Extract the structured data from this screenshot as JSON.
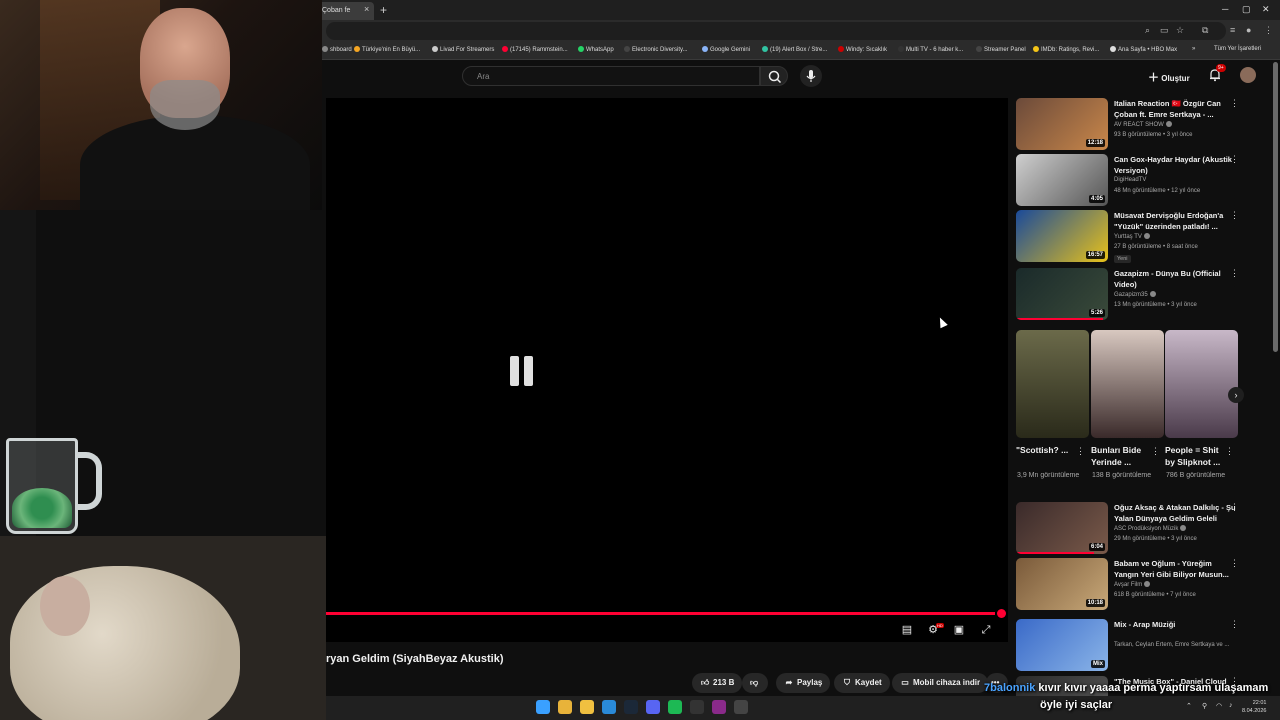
{
  "browser": {
    "tab_title": "Çoban fe",
    "tab_close": "×",
    "new_tab": "+",
    "bookmarks": [
      {
        "label": "shboard",
        "color": "#888"
      },
      {
        "label": "Türkiye'nin En Büyü...",
        "color": "#f5a623"
      },
      {
        "label": "Livad For Streamers",
        "color": "#cccccc"
      },
      {
        "label": "(17145) Rammstein...",
        "color": "#ff0033"
      },
      {
        "label": "WhatsApp",
        "color": "#25d366"
      },
      {
        "label": "Electronic Diversity...",
        "color": "#444444"
      },
      {
        "label": "Google Gemini",
        "color": "#8ab4f8"
      },
      {
        "label": "(19) Alert Box / Stre...",
        "color": "#31c3a2"
      },
      {
        "label": "Windy: Sıcaklık",
        "color": "#cc0000"
      },
      {
        "label": "Multi TV - 6 haber k...",
        "color": "#333333"
      },
      {
        "label": "Streamer Panel",
        "color": "#444444"
      },
      {
        "label": "IMDb: Ratings, Revi...",
        "color": "#f5c518"
      },
      {
        "label": "Ana Sayfa • HBO Max",
        "color": "#dddddd"
      }
    ],
    "bookmarks_more": "»",
    "all_bookmarks": "Tüm Yer İşaretleri"
  },
  "header": {
    "search_placeholder": "Ara",
    "create_label": "Oluştur",
    "notif_count": "9+"
  },
  "player": {
    "progress_fraction": 0.99,
    "title": "ryan Geldim (SiyahBeyaz Akustik)"
  },
  "actions": {
    "likes": "213 B",
    "share": "Paylaş",
    "save": "Kaydet",
    "download": "Mobil cihaza indir",
    "more": "•••"
  },
  "recommendations": [
    {
      "title": "Italian Reaction 🇹🇷 Özgür Can Çoban ft. Emre Sertkaya - ...",
      "channel": "AV REACT SHOW",
      "verified": true,
      "meta": "93 B görüntüleme • 3 yıl önce",
      "duration": "12:18",
      "thumb": [
        "#6b4a3a",
        "#c9874a"
      ],
      "watched": 0
    },
    {
      "title": "Can Gox-Haydar Haydar (Akustik Versiyon)",
      "channel": "DigiHeadTV",
      "verified": false,
      "meta": "48 Mn görüntüleme • 12 yıl önce",
      "duration": "4:05",
      "thumb": [
        "#cfcfcf",
        "#555555"
      ],
      "watched": 0
    },
    {
      "title": "Müsavat Dervişoğlu Erdoğan'a \"Yüzük\" üzerinden patladı! ...",
      "channel": "Yurttaş TV",
      "verified": true,
      "meta": "27 B görüntüleme • 8 saat önce",
      "duration": "16:57",
      "thumb": [
        "#1a4a9a",
        "#e8c21a"
      ],
      "new": "Yeni",
      "watched": 0
    },
    {
      "title": "Gazapizm - Dünya Bu (Official Video)",
      "channel": "Gazapizm35",
      "verified": true,
      "meta": "13 Mn görüntüleme • 3 yıl önce",
      "duration": "5:26",
      "thumb": [
        "#1a2a2a",
        "#3a4a3a"
      ],
      "watched": 0.95
    }
  ],
  "shorts": [
    {
      "title": "\"Scottish? ...",
      "views": "3,9 Mn görüntüleme",
      "thumb": [
        "#6b6a4a",
        "#2a2a1a"
      ]
    },
    {
      "title": "Bunları Bide Yerinde ...",
      "views": "138 B görüntüleme",
      "thumb": [
        "#d8c8c0",
        "#3a2a2a"
      ]
    },
    {
      "title": "People = Shit by Slipknot ...",
      "views": "786 B görüntüleme",
      "thumb": [
        "#c8b8c8",
        "#4a3a4a"
      ]
    }
  ],
  "recommendations2": [
    {
      "title": "Oğuz Aksaç & Atakan Dalkılıç - Şu Yalan Dünyaya Geldim Geleli",
      "channel": "ASC Prodüksiyon Müzik",
      "verified": true,
      "meta": "29 Mn görüntüleme • 3 yıl önce",
      "duration": "6:04",
      "thumb": [
        "#3a2a2a",
        "#7a5a4a"
      ],
      "watched": 0.85
    },
    {
      "title": "Babam ve Oğlum - Yüreğim Yangın Yeri Gibi Biliyor Musun...",
      "channel": "Avşar Film",
      "verified": true,
      "meta": "618 B görüntüleme • 7 yıl önce",
      "duration": "10:18",
      "thumb": [
        "#7a5a3a",
        "#c8a878"
      ],
      "watched": 0
    },
    {
      "title": "Mix - Arap Müziği",
      "channel": "Tarkan, Ceylan Ertem, Emre Sertkaya ve ...",
      "verified": false,
      "meta": "",
      "duration": "Mix",
      "thumb": [
        "#3a6ac8",
        "#8ab4e8"
      ],
      "watched": 0
    },
    {
      "title": "\"The Music Box\" - Daniel Cloud",
      "channel": "",
      "verified": false,
      "meta": "",
      "duration": "",
      "thumb": [
        "#2a2a2a",
        "#5a5a5a"
      ],
      "watched": 0
    }
  ],
  "chat_overlay": {
    "user": "7balonnik",
    "line1": "kıvır kıvır yaaaa perma yaptırsam ulaşamam",
    "line2": "öyle iyi saçlar"
  },
  "taskbar": {
    "time": "22:01",
    "date": "8.04.2026"
  },
  "colors": {
    "accent": "#ff0033",
    "background": "#0f0f0f",
    "chip": "#272727"
  }
}
